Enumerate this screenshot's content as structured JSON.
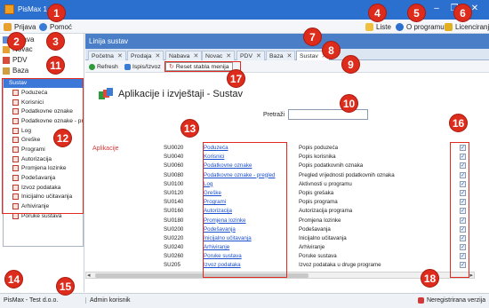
{
  "window": {
    "title": "PisMax 1.0",
    "minimize": "–",
    "maximize": "❐",
    "close": "✕"
  },
  "menubar": {
    "prijava": "Prijava",
    "pomoc": "Pomoć",
    "liste": "Liste",
    "o_programu": "O programu",
    "licenciranje": "Licenciranje"
  },
  "left_nav": {
    "top_items": [
      "Prijava",
      "Novac",
      "PDV",
      "Baza"
    ],
    "tree_header": "Sustav",
    "tree_items": [
      "Poduzeća",
      "Korisnici",
      "Podatkovne oznake",
      "Podatkovne oznake - pregl...",
      "Log",
      "Greške",
      "Programi",
      "Autorizacija",
      "Promjena lozinke",
      "Podešavanja",
      "Izvoz podataka",
      "Inicijalno učitavanja",
      "Arhiviranje",
      "Poruke sustava"
    ]
  },
  "pane": {
    "title": "Linija sustav"
  },
  "tabs": [
    "Početna",
    "Prodaja",
    "Nabava",
    "Novac",
    "PDV",
    "Baza",
    "Sustav"
  ],
  "tab_close": "✕",
  "toolbar": {
    "refresh": "Refresh",
    "ispis": "Ispis/Izvoz",
    "reset": "Reset stabla menija"
  },
  "page": {
    "heading": "Aplikacije i izvještaji - Sustav",
    "search_label": "Pretraži",
    "section_label": "Aplikacije"
  },
  "apps": [
    {
      "code": "SU0020",
      "name": "Poduzeća",
      "desc": "Popis poduzeća"
    },
    {
      "code": "SU0040",
      "name": "Korisnici",
      "desc": "Popis korisnika"
    },
    {
      "code": "SU0060",
      "name": "Podatkovne oznake",
      "desc": "Popis podatkovnih oznaka"
    },
    {
      "code": "SU0080",
      "name": "Podatkovne oznake - pregled",
      "desc": "Pregled vrijednosti podatkovnih oznaka"
    },
    {
      "code": "SU0100",
      "name": "Log",
      "desc": "Aktivnosti u programu"
    },
    {
      "code": "SU0120",
      "name": "Greške",
      "desc": "Popis grešaka"
    },
    {
      "code": "SU0140",
      "name": "Programi",
      "desc": "Popis programa"
    },
    {
      "code": "SU0160",
      "name": "Autorizacija",
      "desc": "Autorizacija programa"
    },
    {
      "code": "SU0180",
      "name": "Promjena lozinke",
      "desc": "Promjena lozinke"
    },
    {
      "code": "SU0200",
      "name": "Podešavanja",
      "desc": "Podešavanja"
    },
    {
      "code": "SU0220",
      "name": "Inicijalno učitavanja",
      "desc": "Inicijalno učitavanja"
    },
    {
      "code": "SU0240",
      "name": "Arhiviranje",
      "desc": "Arhiviranje"
    },
    {
      "code": "SU0260",
      "name": "Poruke sustava",
      "desc": "Poruke sustava"
    },
    {
      "code": "SU205",
      "name": "Izvoz podataka",
      "desc": "Izvoz podataka u druge programe"
    }
  ],
  "check_mark": "✓",
  "statusbar": {
    "company": "PisMax - Test d.o.o.",
    "user": "Admin korisnik",
    "registration": "Neregistrirana verzija"
  },
  "badges": [
    "1",
    "2",
    "3",
    "4",
    "5",
    "6",
    "7",
    "8",
    "9",
    "10",
    "11",
    "12",
    "13",
    "14",
    "15",
    "16",
    "17",
    "18"
  ],
  "colors": {
    "titlebar": "#2b6fcf",
    "badge": "#dd2b1c",
    "link": "#1a4fd0",
    "section": "#d23a3a"
  }
}
